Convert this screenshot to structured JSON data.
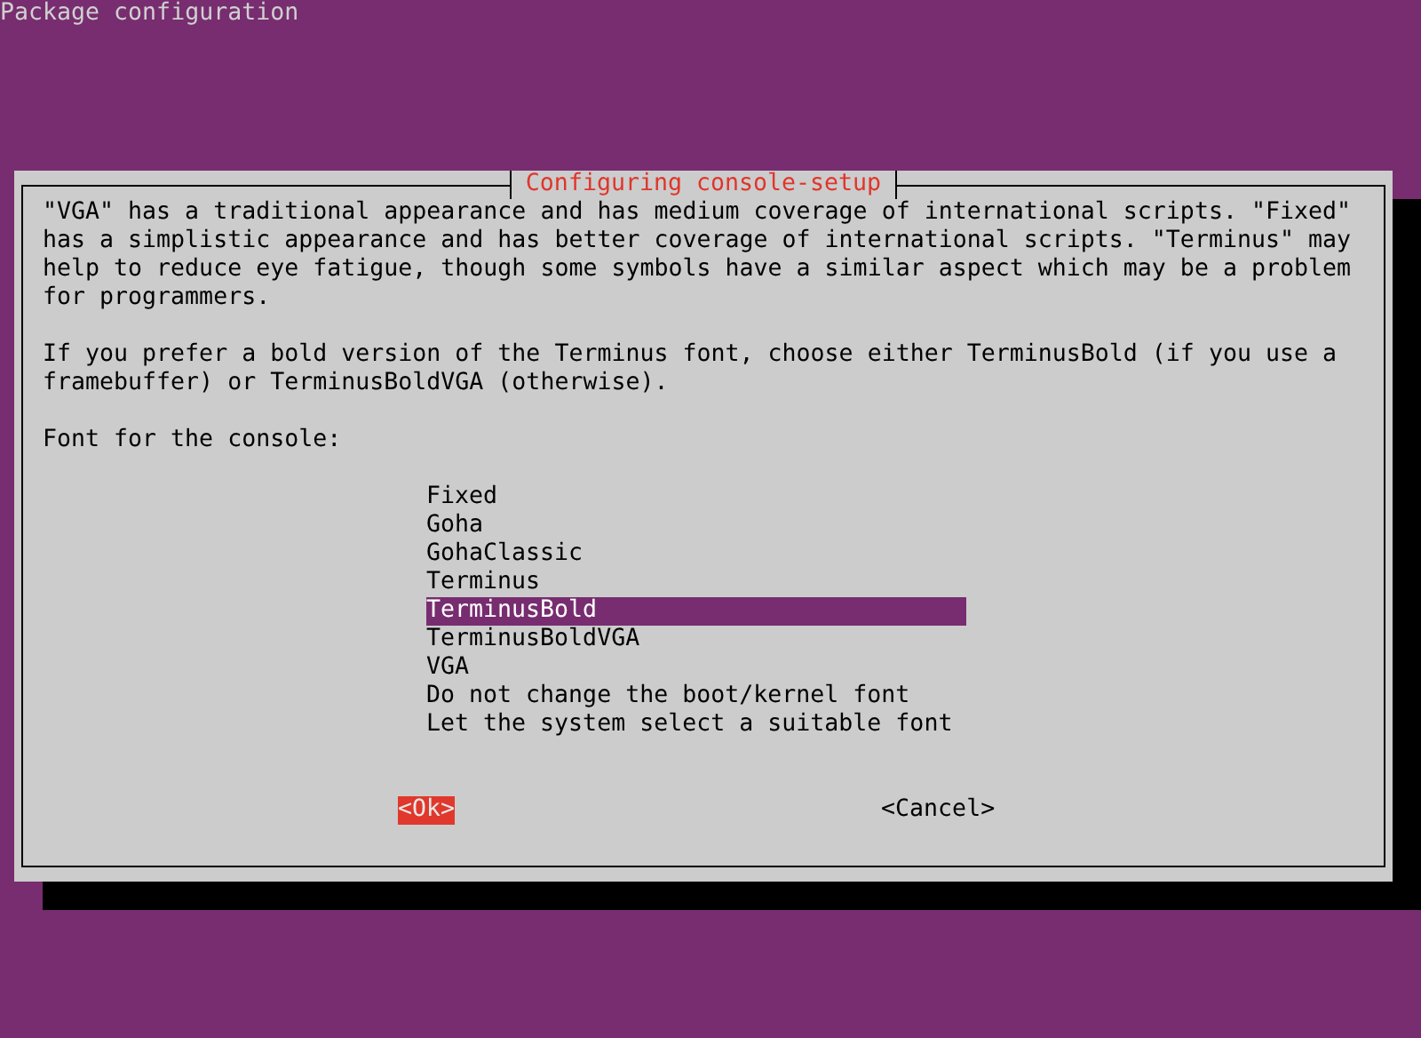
{
  "screen_title": "Package configuration",
  "dialog": {
    "title": "Configuring console-setup",
    "paragraphs": [
      "\"VGA\" has a traditional appearance and has medium coverage of international scripts. \"Fixed\" has a simplistic appearance and has better coverage of international scripts. \"Terminus\" may help to reduce eye fatigue, though some symbols have a similar aspect which may be a problem for programmers.",
      "If you prefer a bold version of the Terminus font, choose either TerminusBold (if you use a framebuffer) or TerminusBoldVGA (otherwise)."
    ],
    "prompt": "Font for the console:",
    "options": [
      {
        "label": "Fixed",
        "selected": false
      },
      {
        "label": "Goha",
        "selected": false
      },
      {
        "label": "GohaClassic",
        "selected": false
      },
      {
        "label": "Terminus",
        "selected": false
      },
      {
        "label": "TerminusBold",
        "selected": true
      },
      {
        "label": "TerminusBoldVGA",
        "selected": false
      },
      {
        "label": "VGA",
        "selected": false
      },
      {
        "label": "Do not change the boot/kernel font",
        "selected": false
      },
      {
        "label": "Let the system select a suitable font",
        "selected": false
      }
    ],
    "buttons": [
      {
        "label": "<Ok>",
        "selected": true
      },
      {
        "label": "<Cancel>",
        "selected": false
      }
    ]
  }
}
